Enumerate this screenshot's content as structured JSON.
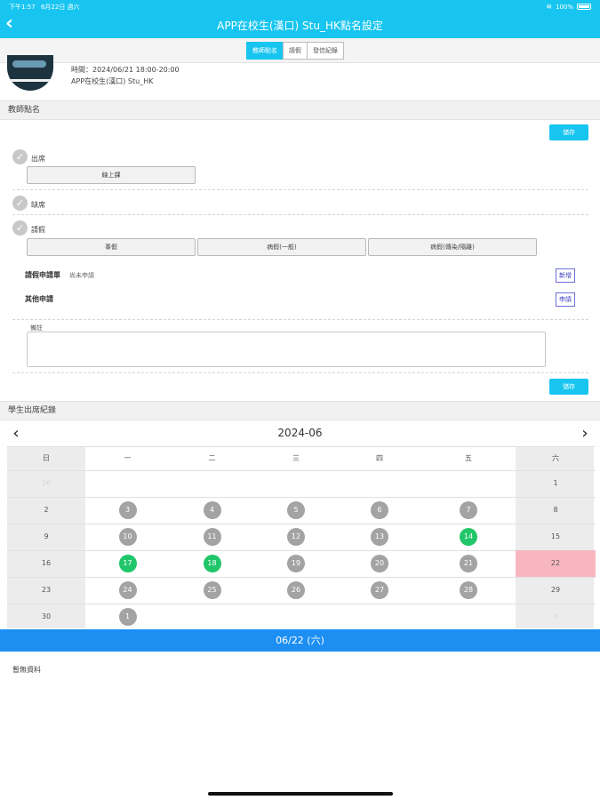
{
  "status_bar": {
    "time": "下午1:57",
    "date": "6月22日 週六",
    "battery": "100%"
  },
  "nav": {
    "back_icon": "chevron-left-icon",
    "title": "APP在校生(漢口) Stu_HK點名設定"
  },
  "segments": [
    {
      "label": "教師點名",
      "active": true
    },
    {
      "label": "請假",
      "active": false
    },
    {
      "label": "發信紀錄",
      "active": false
    }
  ],
  "session": {
    "time": "時間：2024/06/21 18:00-20:00",
    "class": "APP在校生(漢口) Stu_HK"
  },
  "teacher_section": {
    "title": "教師點名",
    "save_label": "儲存",
    "attend_label": "出席",
    "attend_options": [
      "線上課"
    ],
    "absent_label": "缺席",
    "leave_label": "請假",
    "leave_options": [
      "事假",
      "病假(一般)",
      "病假(傳染/隔離)"
    ],
    "leave_form_label": "請假申請單",
    "leave_form_status": "尚未申請",
    "leave_form_button": "新增",
    "other_apply_label": "其他申請",
    "other_apply_button": "申請",
    "notes_label": "備註",
    "notes_value": "",
    "save_label_2": "儲存"
  },
  "attendance": {
    "title": "學生出席紀錄",
    "month": "2024-06",
    "weekdays": [
      "日",
      "一",
      "二",
      "三",
      "四",
      "五",
      "六"
    ],
    "weeks": [
      [
        {
          "d": "26",
          "s": "faded"
        },
        {
          "d": "",
          "s": ""
        },
        {
          "d": "",
          "s": ""
        },
        {
          "d": "",
          "s": ""
        },
        {
          "d": "",
          "s": ""
        },
        {
          "d": "",
          "s": ""
        },
        {
          "d": "1",
          "s": ""
        }
      ],
      [
        {
          "d": "2",
          "s": ""
        },
        {
          "d": "3",
          "s": "grey"
        },
        {
          "d": "4",
          "s": "grey"
        },
        {
          "d": "5",
          "s": "grey"
        },
        {
          "d": "6",
          "s": "grey"
        },
        {
          "d": "7",
          "s": "grey"
        },
        {
          "d": "8",
          "s": ""
        }
      ],
      [
        {
          "d": "9",
          "s": ""
        },
        {
          "d": "10",
          "s": "grey"
        },
        {
          "d": "11",
          "s": "grey"
        },
        {
          "d": "12",
          "s": "grey"
        },
        {
          "d": "13",
          "s": "grey"
        },
        {
          "d": "14",
          "s": "green"
        },
        {
          "d": "15",
          "s": ""
        }
      ],
      [
        {
          "d": "16",
          "s": ""
        },
        {
          "d": "17",
          "s": "green"
        },
        {
          "d": "18",
          "s": "green"
        },
        {
          "d": "19",
          "s": "grey"
        },
        {
          "d": "20",
          "s": "grey"
        },
        {
          "d": "21",
          "s": "grey"
        },
        {
          "d": "22",
          "s": "selected"
        }
      ],
      [
        {
          "d": "23",
          "s": ""
        },
        {
          "d": "24",
          "s": "grey"
        },
        {
          "d": "25",
          "s": "grey"
        },
        {
          "d": "26",
          "s": "grey"
        },
        {
          "d": "27",
          "s": "grey"
        },
        {
          "d": "28",
          "s": "grey"
        },
        {
          "d": "29",
          "s": ""
        }
      ],
      [
        {
          "d": "30",
          "s": ""
        },
        {
          "d": "1",
          "s": "grey"
        },
        {
          "d": "",
          "s": ""
        },
        {
          "d": "",
          "s": ""
        },
        {
          "d": "",
          "s": ""
        },
        {
          "d": "",
          "s": ""
        },
        {
          "d": "6",
          "s": "faded"
        }
      ]
    ],
    "selected_date": "06/22 (六)",
    "no_data": "暫無資料"
  },
  "colors": {
    "primary": "#17c5f0",
    "date_bar": "#1d8ef2",
    "attended": "#21c66a",
    "grey_day": "#a3a3a3",
    "selected_day": "#f8b7c0"
  }
}
